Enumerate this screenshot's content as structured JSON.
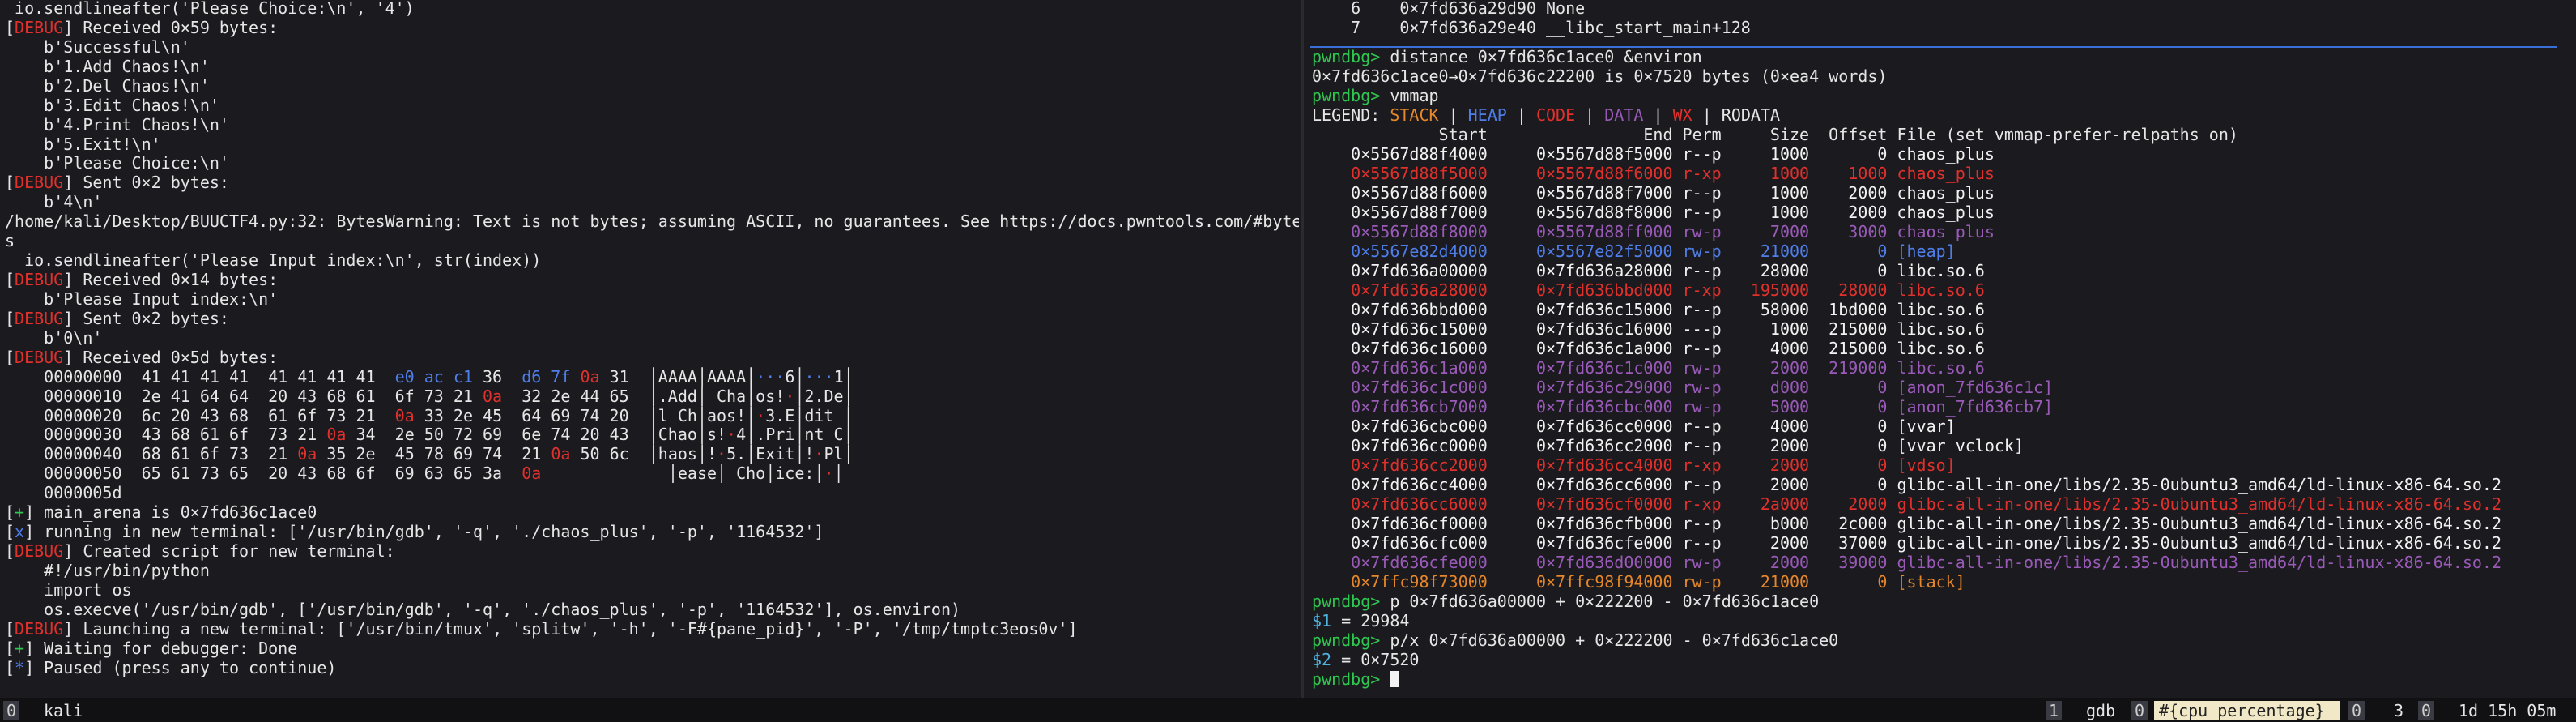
{
  "left_lines": [
    [
      {
        "t": " io.sendlineafter('Please Choice:\\n', '4')",
        "c": ""
      }
    ],
    [
      {
        "t": "[",
        "c": "bracket"
      },
      {
        "t": "DEBUG",
        "c": "c-red"
      },
      {
        "t": "] Received 0×59 bytes:",
        "c": ""
      }
    ],
    [
      {
        "t": "    b'Successful\\n'",
        "c": ""
      }
    ],
    [
      {
        "t": "    b'1.Add Chaos!\\n'",
        "c": ""
      }
    ],
    [
      {
        "t": "    b'2.Del Chaos!\\n'",
        "c": ""
      }
    ],
    [
      {
        "t": "    b'3.Edit Chaos!\\n'",
        "c": ""
      }
    ],
    [
      {
        "t": "    b'4.Print Chaos!\\n'",
        "c": ""
      }
    ],
    [
      {
        "t": "    b'5.Exit!\\n'",
        "c": ""
      }
    ],
    [
      {
        "t": "    b'Please Choice:\\n'",
        "c": ""
      }
    ],
    [
      {
        "t": "[",
        "c": "bracket"
      },
      {
        "t": "DEBUG",
        "c": "c-red"
      },
      {
        "t": "] Sent 0×2 bytes:",
        "c": ""
      }
    ],
    [
      {
        "t": "    b'4\\n'",
        "c": ""
      }
    ],
    [
      {
        "t": "/home/kali/Desktop/BUUCTF4.py:32: BytesWarning: Text is not bytes; assuming ASCII, no guarantees. See https://docs.pwntools.com/#byte",
        "c": ""
      }
    ],
    [
      {
        "t": "s",
        "c": ""
      }
    ],
    [
      {
        "t": "  io.sendlineafter('Please Input index:\\n', str(index))",
        "c": ""
      }
    ],
    [
      {
        "t": "[",
        "c": "bracket"
      },
      {
        "t": "DEBUG",
        "c": "c-red"
      },
      {
        "t": "] Received 0×14 bytes:",
        "c": ""
      }
    ],
    [
      {
        "t": "    b'Please Input index:\\n'",
        "c": ""
      }
    ],
    [
      {
        "t": "[",
        "c": "bracket"
      },
      {
        "t": "DEBUG",
        "c": "c-red"
      },
      {
        "t": "] Sent 0×2 bytes:",
        "c": ""
      }
    ],
    [
      {
        "t": "    b'0\\n'",
        "c": ""
      }
    ],
    [
      {
        "t": "[",
        "c": "bracket"
      },
      {
        "t": "DEBUG",
        "c": "c-red"
      },
      {
        "t": "] Received 0×5d bytes:",
        "c": ""
      }
    ],
    [
      {
        "t": "    00000000  41 41 41 41  41 41 41 41  ",
        "c": ""
      },
      {
        "t": "e0 ac c1",
        "c": "c-blue"
      },
      {
        "t": " 36  ",
        "c": ""
      },
      {
        "t": "d6 7f",
        "c": "c-blue"
      },
      {
        "t": " ",
        "c": ""
      },
      {
        "t": "0a",
        "c": "c-red"
      },
      {
        "t": " 31  ",
        "c": ""
      },
      {
        "t": "│AAAA│AAAA│",
        "c": ""
      },
      {
        "t": "···",
        "c": "c-blue"
      },
      {
        "t": "6│",
        "c": ""
      },
      {
        "t": "···",
        "c": "c-blue"
      },
      {
        "t": "1│",
        "c": ""
      }
    ],
    [
      {
        "t": "    00000010  2e 41 64 64  20 43 68 61  6f 73 21 ",
        "c": ""
      },
      {
        "t": "0a",
        "c": "c-red"
      },
      {
        "t": "  32 2e 44 65  │.Add│ Cha│os!",
        "c": ""
      },
      {
        "t": "·",
        "c": "c-red"
      },
      {
        "t": "│2.De│",
        "c": ""
      }
    ],
    [
      {
        "t": "    00000020  6c 20 43 68  61 6f 73 21  ",
        "c": ""
      },
      {
        "t": "0a",
        "c": "c-red"
      },
      {
        "t": " 33 2e 45  64 69 74 20  │l Ch│aos!│",
        "c": ""
      },
      {
        "t": "·",
        "c": "c-red"
      },
      {
        "t": "3.E│dit │",
        "c": ""
      }
    ],
    [
      {
        "t": "    00000030  43 68 61 6f  73 21 ",
        "c": ""
      },
      {
        "t": "0a",
        "c": "c-red"
      },
      {
        "t": " 34  2e 50 72 69  6e 74 20 43  │Chao│s!",
        "c": ""
      },
      {
        "t": "·",
        "c": "c-red"
      },
      {
        "t": "4│.Pri│nt C│",
        "c": ""
      }
    ],
    [
      {
        "t": "    00000040  68 61 6f 73  21 ",
        "c": ""
      },
      {
        "t": "0a",
        "c": "c-red"
      },
      {
        "t": " 35 2e  45 78 69 74  21 ",
        "c": ""
      },
      {
        "t": "0a",
        "c": "c-red"
      },
      {
        "t": " 50 6c  │haos│!",
        "c": ""
      },
      {
        "t": "·",
        "c": "c-red"
      },
      {
        "t": "5.│Exit│!",
        "c": ""
      },
      {
        "t": "·",
        "c": "c-red"
      },
      {
        "t": "Pl│",
        "c": ""
      }
    ],
    [
      {
        "t": "    00000050  65 61 73 65  20 43 68 6f  69 63 65 3a  ",
        "c": ""
      },
      {
        "t": "0a",
        "c": "c-red"
      },
      {
        "t": "             │ease│ Cho│ice:│",
        "c": ""
      },
      {
        "t": "·",
        "c": "c-red"
      },
      {
        "t": "│",
        "c": ""
      }
    ],
    [
      {
        "t": "    0000005d",
        "c": ""
      }
    ],
    [
      {
        "t": "[",
        "c": "bracket"
      },
      {
        "t": "+",
        "c": "c-green"
      },
      {
        "t": "] main_arena is 0×7fd636c1ace0",
        "c": ""
      }
    ],
    [
      {
        "t": "[",
        "c": "bracket"
      },
      {
        "t": "x",
        "c": "c-blue"
      },
      {
        "t": "] running in new terminal: ['/usr/bin/gdb', '-q', './chaos_plus', '-p', '1164532']",
        "c": ""
      }
    ],
    [
      {
        "t": "[",
        "c": "bracket"
      },
      {
        "t": "DEBUG",
        "c": "c-red"
      },
      {
        "t": "] Created script for new terminal:",
        "c": ""
      }
    ],
    [
      {
        "t": "    #!/usr/bin/python",
        "c": ""
      }
    ],
    [
      {
        "t": "    import os",
        "c": ""
      }
    ],
    [
      {
        "t": "    os.execve('/usr/bin/gdb', ['/usr/bin/gdb', '-q', './chaos_plus', '-p', '1164532'], os.environ)",
        "c": ""
      }
    ],
    [
      {
        "t": "[",
        "c": "bracket"
      },
      {
        "t": "DEBUG",
        "c": "c-red"
      },
      {
        "t": "] Launching a new terminal: ['/usr/bin/tmux', 'splitw', '-h', '-F#{pane_pid}', '-P', '/tmp/tmptc3eos0v']",
        "c": ""
      }
    ],
    [
      {
        "t": "[",
        "c": "bracket"
      },
      {
        "t": "+",
        "c": "c-green"
      },
      {
        "t": "] Waiting for debugger: Done",
        "c": ""
      }
    ],
    [
      {
        "t": "[",
        "c": "bracket"
      },
      {
        "t": "*",
        "c": "c-blue"
      },
      {
        "t": "] Paused (press any to continue)",
        "c": ""
      }
    ]
  ],
  "right_lines_top": [
    [
      {
        "t": "    6    0×7fd636a29d90 None",
        "c": ""
      }
    ],
    [
      {
        "t": "    7    0×7fd636a29e40 __libc_start_main+128",
        "c": ""
      }
    ]
  ],
  "right_lines": [
    [
      {
        "t": "pwndbg>",
        "c": "c-green"
      },
      {
        "t": " distance 0×7fd636c1ace0 &environ",
        "c": ""
      }
    ],
    [
      {
        "t": "0×7fd636c1ace0→0×7fd636c22200 is 0×7520 bytes (0×ea4 words)",
        "c": ""
      }
    ],
    [
      {
        "t": "pwndbg>",
        "c": "c-green"
      },
      {
        "t": " vmmap",
        "c": ""
      }
    ],
    [
      {
        "t": "LEGEND: ",
        "c": ""
      },
      {
        "t": "STACK",
        "c": "c-orange"
      },
      {
        "t": " | ",
        "c": ""
      },
      {
        "t": "HEAP",
        "c": "c-blue"
      },
      {
        "t": " | ",
        "c": ""
      },
      {
        "t": "CODE",
        "c": "c-red"
      },
      {
        "t": " | ",
        "c": ""
      },
      {
        "t": "DATA",
        "c": "c-purple"
      },
      {
        "t": " | ",
        "c": ""
      },
      {
        "t": "WX",
        "c": "c-red"
      },
      {
        "t": " | RODATA",
        "c": ""
      }
    ],
    [
      {
        "t": "             Start                End Perm     Size  Offset File (set vmmap-prefer-relpaths on)",
        "c": ""
      }
    ],
    [
      {
        "t": "    0×5567d88f4000     0×5567d88f5000 r--p     1000       0 chaos_plus",
        "c": "c-white"
      }
    ],
    [
      {
        "t": "    0×5567d88f5000     0×5567d88f6000 r-xp     1000    1000 chaos_plus",
        "c": "c-red"
      }
    ],
    [
      {
        "t": "    0×5567d88f6000     0×5567d88f7000 r--p     1000    2000 chaos_plus",
        "c": "c-white"
      }
    ],
    [
      {
        "t": "    0×5567d88f7000     0×5567d88f8000 r--p     1000    2000 chaos_plus",
        "c": "c-white"
      }
    ],
    [
      {
        "t": "    0×5567d88f8000     0×5567d88ff000 rw-p     7000    3000 chaos_plus",
        "c": "c-purple"
      }
    ],
    [
      {
        "t": "    0×5567e82d4000     0×5567e82f5000 rw-p    21000       0 [heap]",
        "c": "c-blue"
      }
    ],
    [
      {
        "t": "    0×7fd636a00000     0×7fd636a28000 r--p    28000       0 libc.so.6",
        "c": "c-white"
      }
    ],
    [
      {
        "t": "    0×7fd636a28000     0×7fd636bbd000 r-xp   195000   28000 libc.so.6",
        "c": "c-red"
      }
    ],
    [
      {
        "t": "    0×7fd636bbd000     0×7fd636c15000 r--p    58000  1bd000 libc.so.6",
        "c": "c-white"
      }
    ],
    [
      {
        "t": "    0×7fd636c15000     0×7fd636c16000 ---p     1000  215000 libc.so.6",
        "c": "c-white"
      }
    ],
    [
      {
        "t": "    0×7fd636c16000     0×7fd636c1a000 r--p     4000  215000 libc.so.6",
        "c": "c-white"
      }
    ],
    [
      {
        "t": "    0×7fd636c1a000     0×7fd636c1c000 rw-p     2000  219000 libc.so.6",
        "c": "c-purple"
      }
    ],
    [
      {
        "t": "    0×7fd636c1c000     0×7fd636c29000 rw-p     d000       0 [anon_7fd636c1c]",
        "c": "c-purple"
      }
    ],
    [
      {
        "t": "    0×7fd636cb7000     0×7fd636cbc000 rw-p     5000       0 [anon_7fd636cb7]",
        "c": "c-purple"
      }
    ],
    [
      {
        "t": "    0×7fd636cbc000     0×7fd636cc0000 r--p     4000       0 [vvar]",
        "c": "c-white"
      }
    ],
    [
      {
        "t": "    0×7fd636cc0000     0×7fd636cc2000 r--p     2000       0 [vvar_vclock]",
        "c": "c-white"
      }
    ],
    [
      {
        "t": "    0×7fd636cc2000     0×7fd636cc4000 r-xp     2000       0 [vdso]",
        "c": "c-red"
      }
    ],
    [
      {
        "t": "    0×7fd636cc4000     0×7fd636cc6000 r--p     2000       0 glibc-all-in-one/libs/2.35-0ubuntu3_amd64/ld-linux-x86-64.so.2",
        "c": "c-white"
      }
    ],
    [
      {
        "t": "    0×7fd636cc6000     0×7fd636cf0000 r-xp    2a000    2000 glibc-all-in-one/libs/2.35-0ubuntu3_amd64/ld-linux-x86-64.so.2",
        "c": "c-red"
      }
    ],
    [
      {
        "t": "    0×7fd636cf0000     0×7fd636cfb000 r--p     b000   2c000 glibc-all-in-one/libs/2.35-0ubuntu3_amd64/ld-linux-x86-64.so.2",
        "c": "c-white"
      }
    ],
    [
      {
        "t": "    0×7fd636cfc000     0×7fd636cfe000 r--p     2000   37000 glibc-all-in-one/libs/2.35-0ubuntu3_amd64/ld-linux-x86-64.so.2",
        "c": "c-white"
      }
    ],
    [
      {
        "t": "    0×7fd636cfe000     0×7fd636d00000 rw-p     2000   39000 glibc-all-in-one/libs/2.35-0ubuntu3_amd64/ld-linux-x86-64.so.2",
        "c": "c-purple"
      }
    ],
    [
      {
        "t": "    0×7ffc98f73000     0×7ffc98f94000 rw-p    21000       0 [stack]",
        "c": "c-orange"
      }
    ],
    [
      {
        "t": "pwndbg>",
        "c": "c-green"
      },
      {
        "t": " p 0×7fd636a00000 + 0×222200 - 0×7fd636c1ace0",
        "c": ""
      }
    ],
    [
      {
        "t": "$1",
        "c": "c-cyan"
      },
      {
        "t": " = 29984",
        "c": ""
      }
    ],
    [
      {
        "t": "pwndbg>",
        "c": "c-green"
      },
      {
        "t": " p/x 0×7fd636a00000 + 0×222200 - 0×7fd636c1ace0",
        "c": ""
      }
    ],
    [
      {
        "t": "$2",
        "c": "c-cyan"
      },
      {
        "t": " = 0×7520",
        "c": ""
      }
    ],
    [
      {
        "t": "pwndbg>",
        "c": "c-green"
      },
      {
        "t": " ",
        "c": ""
      }
    ]
  ],
  "status": {
    "session_badge": "0",
    "window_name": "kali",
    "right_badge1": "1",
    "gdb_label": "gdb",
    "right_badge2": "0",
    "cpu_label": "#{cpu_percentage}",
    "right_badge3": "0",
    "count": "3",
    "right_badge4": "0",
    "uptime": "1d 15h 05m"
  }
}
